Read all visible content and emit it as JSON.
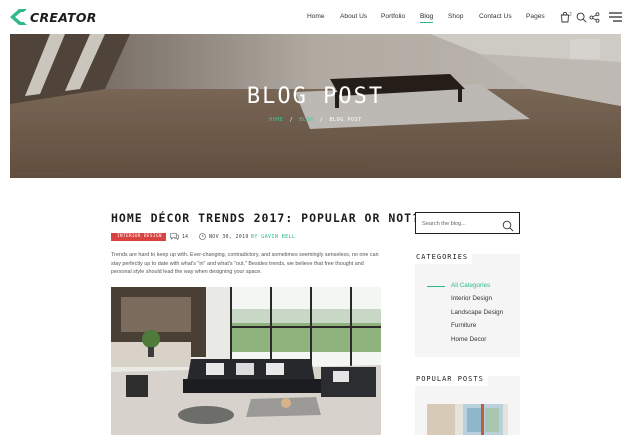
{
  "header": {
    "logo_text": "CREATOR",
    "nav": [
      {
        "label": "Home"
      },
      {
        "label": "About Us"
      },
      {
        "label": "Portfolio"
      },
      {
        "label": "Blog",
        "active": true
      },
      {
        "label": "Shop"
      },
      {
        "label": "Contact Us"
      },
      {
        "label": "Pages"
      }
    ],
    "cart_count": "2",
    "icons": [
      "cart-icon",
      "search-icon",
      "share-icon",
      "menu-icon"
    ]
  },
  "hero": {
    "title": "BLOG POST",
    "breadcrumb": {
      "home": "HOME",
      "blog": "BLOG",
      "current": "BLOG POST",
      "separator": "/"
    }
  },
  "post": {
    "title": "HOME DÉCOR TRENDS 2017: POPULAR OR NOT?",
    "category": "INTERIOR DESIGN",
    "comments": "14",
    "date": "NOV 30, 2019",
    "author": "BY GAVIN BELL",
    "excerpt": "Trends are hard to keep up with. Ever-changing, contradictory, and sometimes seemingly senseless, no one can stay perfectly up to date with what's \"in\" and what's \"out.\" Besides trends, we believe that free thought and personal style should lead the way when designing your space."
  },
  "sidebar": {
    "search_placeholder": "Search the blog...",
    "categories_title": "CATEGORIES",
    "categories": [
      {
        "label": "All Categories",
        "active": true
      },
      {
        "label": "Interior Design"
      },
      {
        "label": "Landscape Design"
      },
      {
        "label": "Furniture"
      },
      {
        "label": "Home Decor"
      }
    ],
    "popular_title": "POPULAR POSTS"
  },
  "colors": {
    "accent": "#2fb98b",
    "tag": "#d9423e",
    "text": "#1d1d1d"
  }
}
